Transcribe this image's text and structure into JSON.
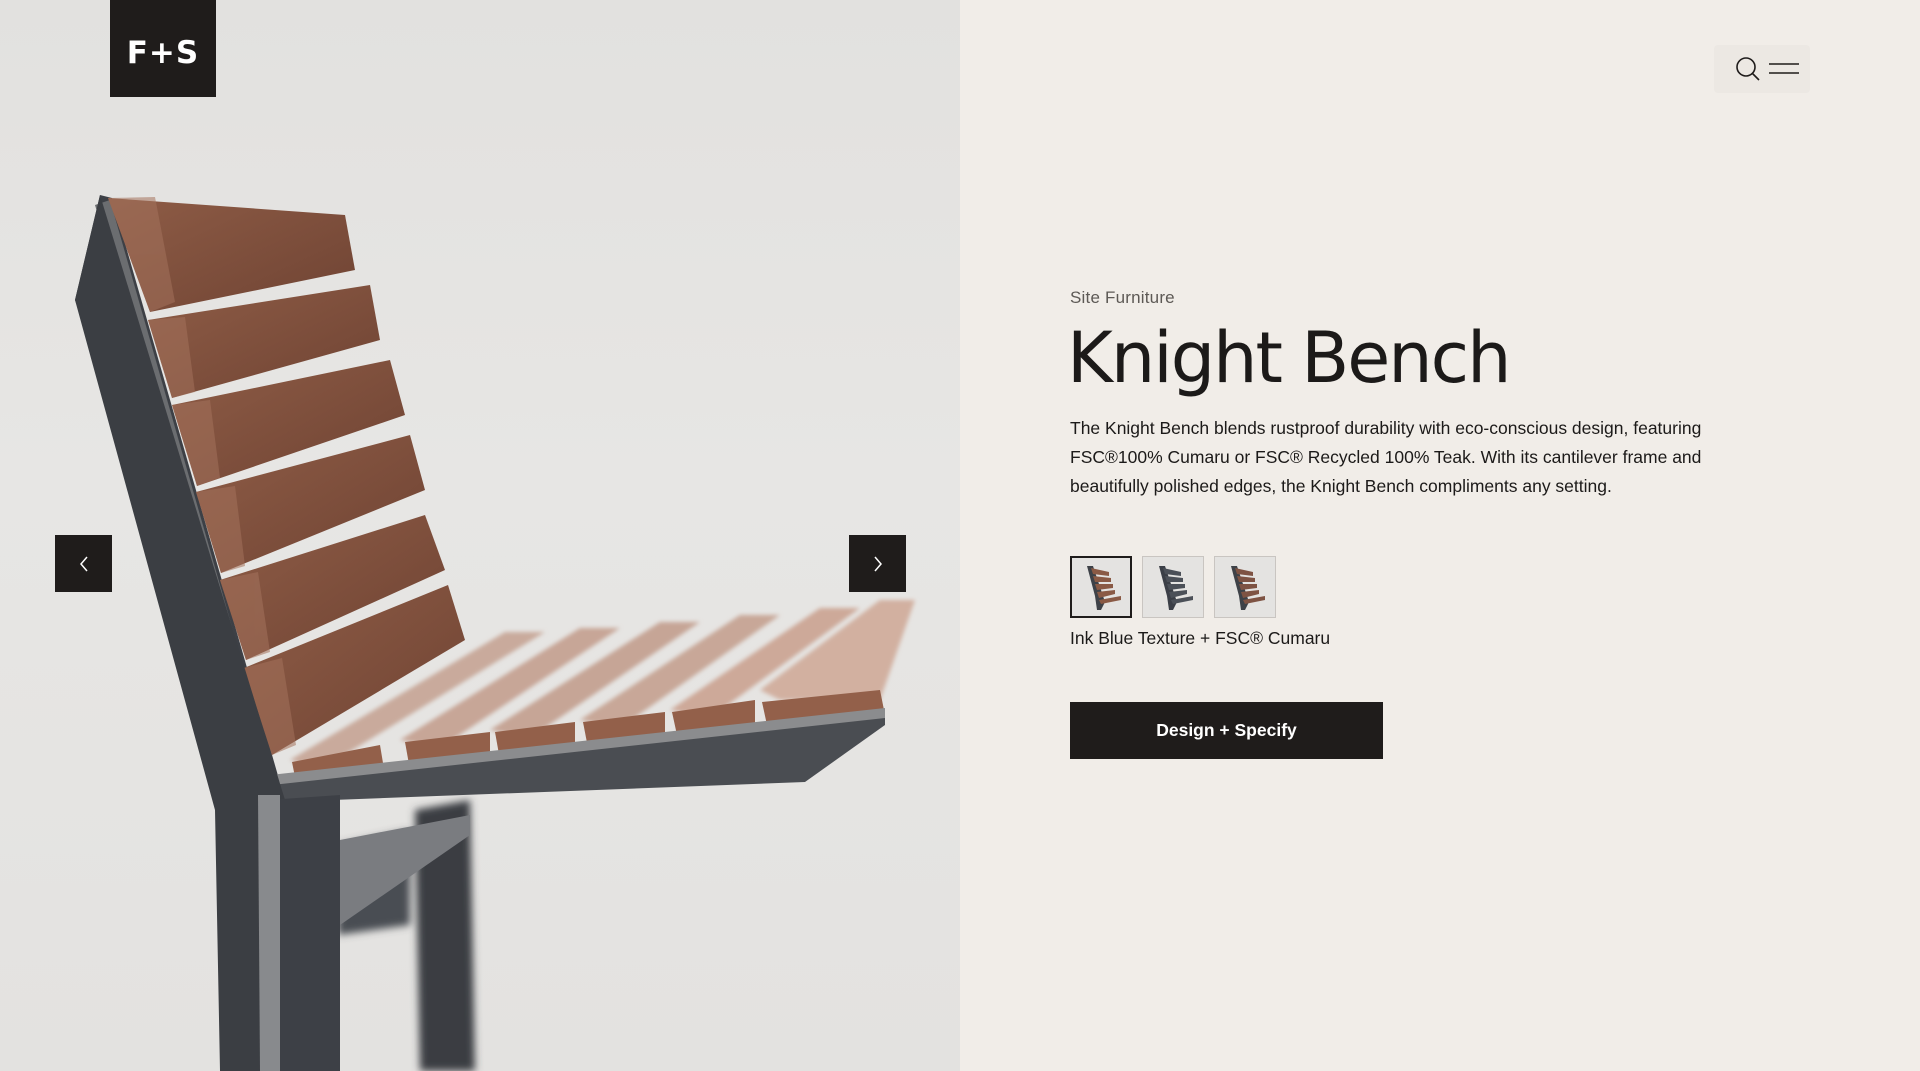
{
  "brand": {
    "logo_text": "F+S"
  },
  "header": {
    "search_icon": "search-icon",
    "menu_icon": "hamburger-menu-icon"
  },
  "gallery": {
    "prev_icon": "chevron-left-icon",
    "next_icon": "chevron-right-icon"
  },
  "product": {
    "category": "Site Furniture",
    "name": "Knight Bench",
    "description": "The Knight Bench blends rustproof durability with eco-conscious design, featuring FSC®100% Cumaru or FSC® Recycled 100% Teak. With its cantilever frame and beautifully polished edges, the Knight Bench compliments any setting.",
    "selected_finish": "Ink Blue Texture + FSC® Cumaru",
    "swatches": [
      {
        "frame_color": "#3e4248",
        "wood_color": "#8a5a45",
        "selected": true
      },
      {
        "frame_color": "#3b3f47",
        "wood_color": "#4b5058",
        "selected": false
      },
      {
        "frame_color": "#3e4248",
        "wood_color": "#7e5343",
        "selected": false
      }
    ],
    "cta_label": "Design + Specify"
  },
  "colors": {
    "dark": "#1f1c1b",
    "panel_right": "#f1ede8",
    "panel_left": "#e4e3e1",
    "wood": "#8a5a45",
    "frame": "#3e4248"
  }
}
